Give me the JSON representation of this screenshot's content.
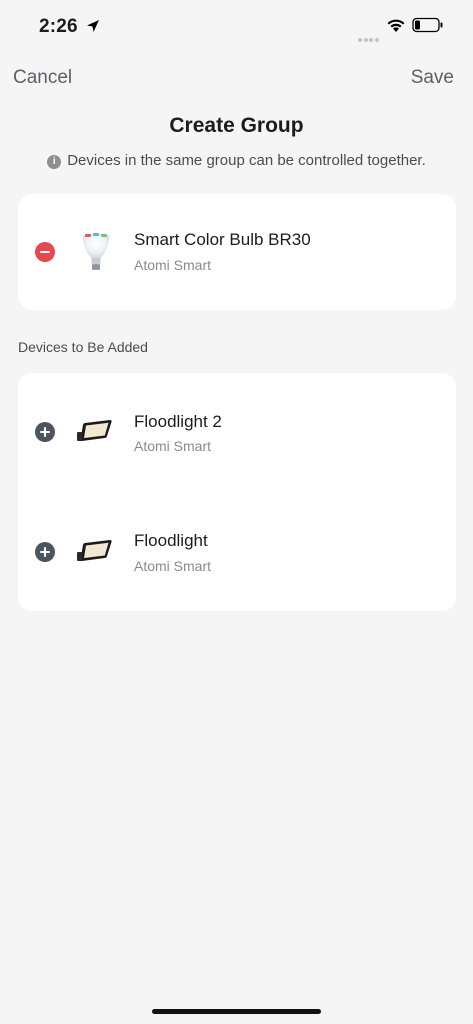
{
  "status_bar": {
    "time": "2:26",
    "location_icon": "location-arrow-icon",
    "wifi_icon": "wifi-icon",
    "battery_icon": "battery-low-icon"
  },
  "nav": {
    "cancel_label": "Cancel",
    "save_label": "Save"
  },
  "title": "Create Group",
  "info": {
    "icon": "info-icon",
    "text": "Devices in the same group can be controlled together."
  },
  "group_devices": [
    {
      "name": "Smart Color Bulb BR30",
      "brand": "Atomi Smart",
      "action": "remove",
      "image": "color-bulb-image"
    }
  ],
  "section_label": "Devices to Be Added",
  "available_devices": [
    {
      "name": "Floodlight 2",
      "brand": "Atomi Smart",
      "action": "add",
      "image": "floodlight-image"
    },
    {
      "name": "Floodlight",
      "brand": "Atomi Smart",
      "action": "add",
      "image": "floodlight-image"
    }
  ],
  "colors": {
    "remove": "#e5484d",
    "add": "#4a5560",
    "nav_text": "#5a5f66",
    "background": "#f5f5f5"
  }
}
